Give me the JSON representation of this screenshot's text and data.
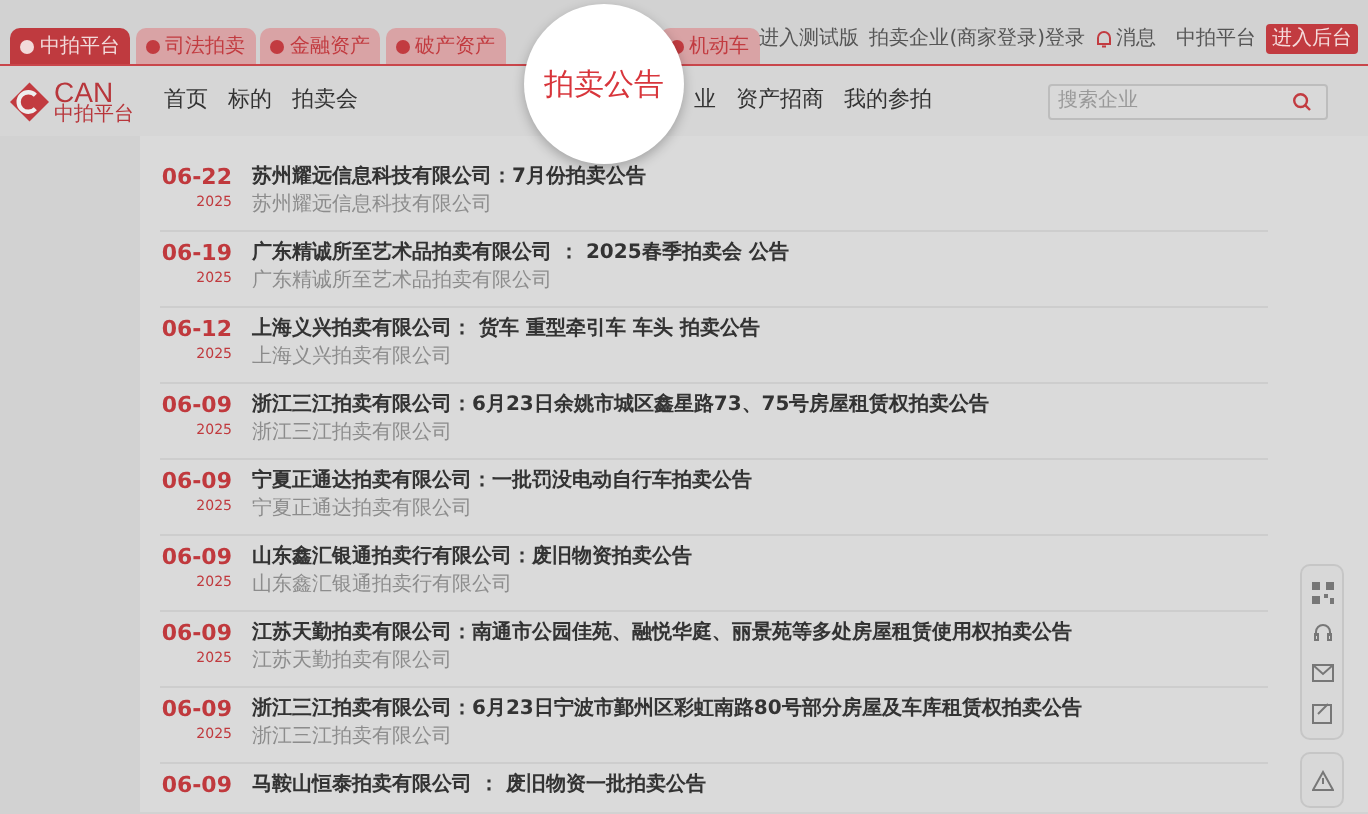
{
  "platform_tabs": [
    {
      "label": "中拍平台",
      "selected": true
    },
    {
      "label": "司法拍卖",
      "selected": false
    },
    {
      "label": "金融资产",
      "selected": false
    },
    {
      "label": "破产资产",
      "selected": false
    }
  ],
  "platform_tabs_after_magnifier": [
    {
      "label": "机动车",
      "selected": false
    }
  ],
  "top_links": [
    "进入测试版",
    "拍卖企业(商家登录)登录"
  ],
  "messages_link": "消息",
  "account": {
    "label": "中拍平台",
    "badge": "进入后台"
  },
  "logo": {
    "text": "CAN",
    "subtitle": "中拍平台"
  },
  "nav_links": [
    "首页",
    "标的",
    "拍卖会"
  ],
  "magnifier": {
    "text": "拍卖公告"
  },
  "nav_links_after_magnifier": [
    "业",
    "资产招商",
    "我的参拍"
  ],
  "search": {
    "placeholder": "搜索企业"
  },
  "announcements": [
    {
      "date": "06-22",
      "year": "2025",
      "title": "苏州耀远信息科技有限公司：7月份拍卖公告",
      "company": "苏州耀远信息科技有限公司"
    },
    {
      "date": "06-19",
      "year": "2025",
      "title": "广东精诚所至艺术品拍卖有限公司 ： 2025春季拍卖会 公告",
      "company": "广东精诚所至艺术品拍卖有限公司"
    },
    {
      "date": "06-12",
      "year": "2025",
      "title": "上海义兴拍卖有限公司： 货车 重型牵引车 车头 拍卖公告",
      "company": "上海义兴拍卖有限公司"
    },
    {
      "date": "06-09",
      "year": "2025",
      "title": "浙江三江拍卖有限公司：6月23日余姚市城区鑫星路73、75号房屋租赁权拍卖公告",
      "company": "浙江三江拍卖有限公司"
    },
    {
      "date": "06-09",
      "year": "2025",
      "title": "宁夏正通达拍卖有限公司：一批罚没电动自行车拍卖公告",
      "company": "宁夏正通达拍卖有限公司"
    },
    {
      "date": "06-09",
      "year": "2025",
      "title": "山东鑫汇银通拍卖行有限公司：废旧物资拍卖公告",
      "company": "山东鑫汇银通拍卖行有限公司"
    },
    {
      "date": "06-09",
      "year": "2025",
      "title": "江苏天勤拍卖有限公司：南通市公园佳苑、融悦华庭、丽景苑等多处房屋租赁使用权拍卖公告",
      "company": "江苏天勤拍卖有限公司"
    },
    {
      "date": "06-09",
      "year": "2025",
      "title": "浙江三江拍卖有限公司：6月23日宁波市鄞州区彩虹南路80号部分房屋及车库租赁权拍卖公告",
      "company": "浙江三江拍卖有限公司"
    },
    {
      "date": "06-09",
      "title": "马鞍山恒泰拍卖有限公司 ： 废旧物资一批拍卖公告"
    }
  ]
}
